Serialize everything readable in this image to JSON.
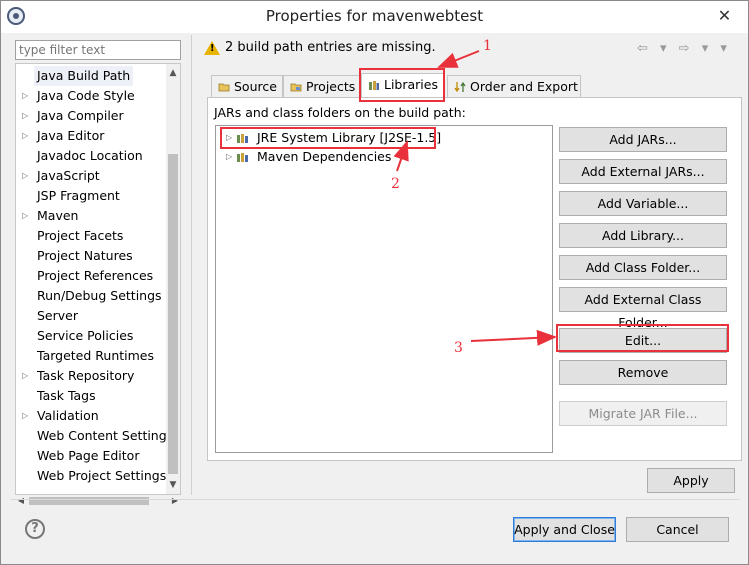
{
  "window": {
    "title": "Properties for mavenwebtest",
    "close_glyph": "✕"
  },
  "filter": {
    "placeholder": "type filter text"
  },
  "nav_tree": {
    "items": [
      {
        "label": "Java Build Path",
        "expandable": false,
        "selected": true
      },
      {
        "label": "Java Code Style",
        "expandable": true
      },
      {
        "label": "Java Compiler",
        "expandable": true
      },
      {
        "label": "Java Editor",
        "expandable": true
      },
      {
        "label": "Javadoc Location",
        "expandable": false
      },
      {
        "label": "JavaScript",
        "expandable": true
      },
      {
        "label": "JSP Fragment",
        "expandable": false
      },
      {
        "label": "Maven",
        "expandable": true
      },
      {
        "label": "Project Facets",
        "expandable": false
      },
      {
        "label": "Project Natures",
        "expandable": false
      },
      {
        "label": "Project References",
        "expandable": false
      },
      {
        "label": "Run/Debug Settings",
        "expandable": false
      },
      {
        "label": "Server",
        "expandable": false
      },
      {
        "label": "Service Policies",
        "expandable": false
      },
      {
        "label": "Targeted Runtimes",
        "expandable": false
      },
      {
        "label": "Task Repository",
        "expandable": true
      },
      {
        "label": "Task Tags",
        "expandable": false
      },
      {
        "label": "Validation",
        "expandable": true
      },
      {
        "label": "Web Content Settings",
        "expandable": false
      },
      {
        "label": "Web Page Editor",
        "expandable": false
      },
      {
        "label": "Web Project Settings",
        "expandable": false
      }
    ]
  },
  "message": {
    "text": "2 build path entries are missing.",
    "icon": "warning-icon",
    "nav_glyphs": "⇦ ▾ ⇨ ▾ ▾"
  },
  "tabs": [
    {
      "label": "Source",
      "icon": "source-folder-icon"
    },
    {
      "label": "Projects",
      "icon": "projects-icon"
    },
    {
      "label": "Libraries",
      "icon": "libraries-icon",
      "active": true
    },
    {
      "label": "Order and Export",
      "icon": "order-export-icon"
    }
  ],
  "libraries": {
    "heading": "JARs and class folders on the build path:",
    "entries": [
      {
        "label": "JRE System Library [J2SE-1.5]",
        "icon": "library-icon"
      },
      {
        "label": "Maven Dependencies",
        "icon": "library-icon"
      }
    ]
  },
  "buttons": {
    "add_jars": "Add JARs...",
    "add_external_jars": "Add External JARs...",
    "add_variable": "Add Variable...",
    "add_library": "Add Library...",
    "add_class_folder": "Add Class Folder...",
    "add_external_class_folder": "Add External Class Folder...",
    "edit": "Edit...",
    "remove": "Remove",
    "migrate_jar": "Migrate JAR File...",
    "apply": "Apply",
    "apply_and_close": "Apply and Close",
    "cancel": "Cancel"
  },
  "annotations": {
    "step1": "1",
    "step2": "2",
    "step3": "3"
  },
  "colors": {
    "annotation_red": "#e8313a",
    "warning_yellow": "#e8b400",
    "default_button_border": "#2f7bd6"
  }
}
